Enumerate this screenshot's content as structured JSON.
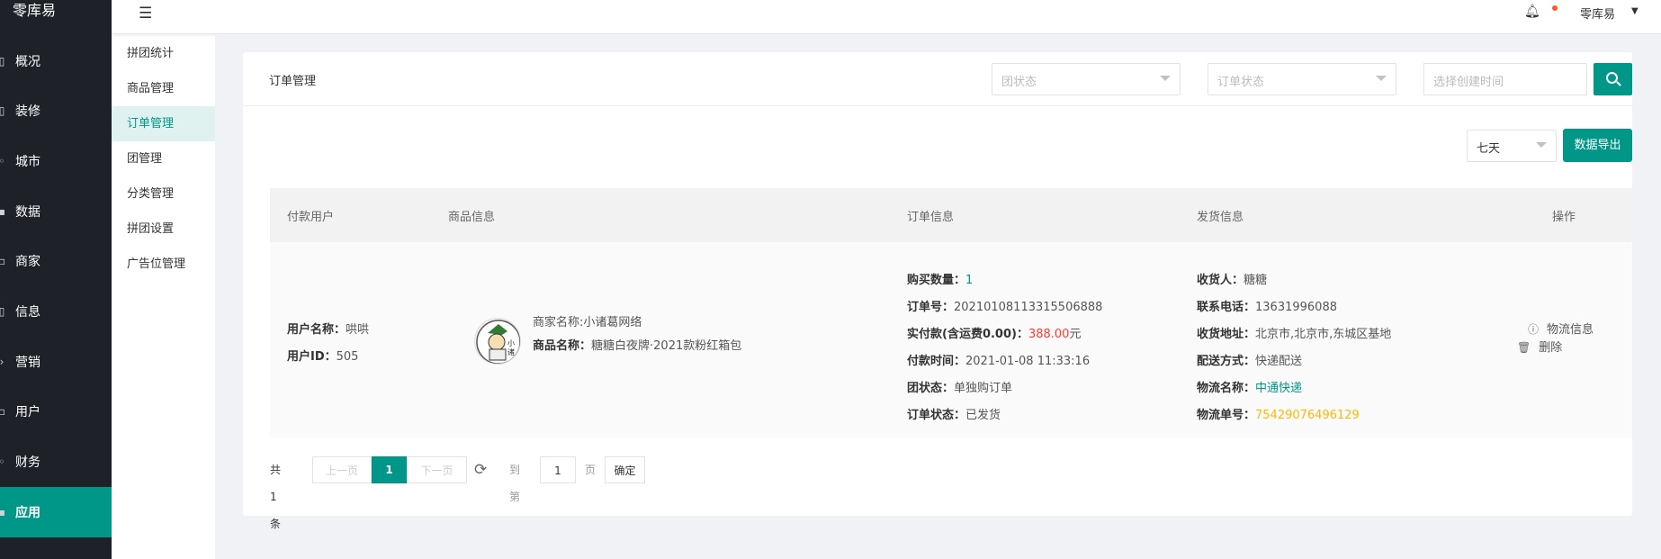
{
  "app": {
    "title": "零库易"
  },
  "nav": {
    "items": [
      {
        "label": "概况",
        "icon": "overview-icon"
      },
      {
        "label": "装修",
        "icon": "decorate-icon"
      },
      {
        "label": "城市",
        "icon": "city-icon"
      },
      {
        "label": "数据",
        "icon": "data-icon"
      },
      {
        "label": "商家",
        "icon": "merchant-icon"
      },
      {
        "label": "信息",
        "icon": "info-icon"
      },
      {
        "label": "营销",
        "icon": "marketing-icon"
      },
      {
        "label": "用户",
        "icon": "user-icon"
      },
      {
        "label": "财务",
        "icon": "finance-icon"
      },
      {
        "label": "应用",
        "icon": "app-icon"
      }
    ],
    "active_index": 9
  },
  "subnav": {
    "items": [
      "拼团统计",
      "商品管理",
      "订单管理",
      "团管理",
      "分类管理",
      "拼团设置",
      "广告位管理"
    ],
    "active_index": 2
  },
  "header": {
    "user_name": "零库易"
  },
  "card": {
    "title": "订单管理",
    "filters": {
      "group_status_placeholder": "团状态",
      "order_status_placeholder": "订单状态",
      "time_placeholder": "选择创建时间"
    },
    "period": "七天",
    "export_label": "数据导出"
  },
  "table": {
    "headers": [
      "付款用户",
      "商品信息",
      "订单信息",
      "发货信息",
      "操作"
    ],
    "row": {
      "user": {
        "name_label": "用户名称：",
        "name": "哄哄",
        "id_label": "用户ID：",
        "id": "505"
      },
      "product": {
        "merchant": "商家名称:小诸葛网络",
        "name_label": "商品名称：",
        "name": "糖糖白夜牌·2021款粉红箱包"
      },
      "order": {
        "qty_label": "购买数量：",
        "qty": "1",
        "no_label": "订单号：",
        "no": "20210108113315506888",
        "paid_label": "实付款(含运费0.00)：",
        "paid": "388.00",
        "paid_unit": "元",
        "time_label": "付款时间：",
        "time": "2021-01-08 11:33:16",
        "group_label": "团状态：",
        "group": "单独购订单",
        "status_label": "订单状态：",
        "status": "已发货"
      },
      "shipping": {
        "receiver_label": "收货人：",
        "receiver": "糖糖",
        "phone_label": "联系电话：",
        "phone": "13631996088",
        "address_label": "收货地址：",
        "address": "北京市,北京市,东城区基地",
        "method_label": "配送方式：",
        "method": "快递配送",
        "company_label": "物流名称：",
        "company": "中通快递",
        "track_label": "物流单号：",
        "track": "75429076496129"
      },
      "actions": {
        "logistics": "物流信息",
        "delete": "删除"
      }
    }
  },
  "pager": {
    "total": "共 1 条",
    "prev": "上一页",
    "current": "1",
    "next": "下一页",
    "goto": "到第",
    "page_input": "1",
    "page_unit": "页",
    "confirm": "确定"
  },
  "colors": {
    "accent": "#009688",
    "nav_bg": "#1e2228",
    "price": "#ff3b30",
    "tracking": "#ffb800"
  }
}
